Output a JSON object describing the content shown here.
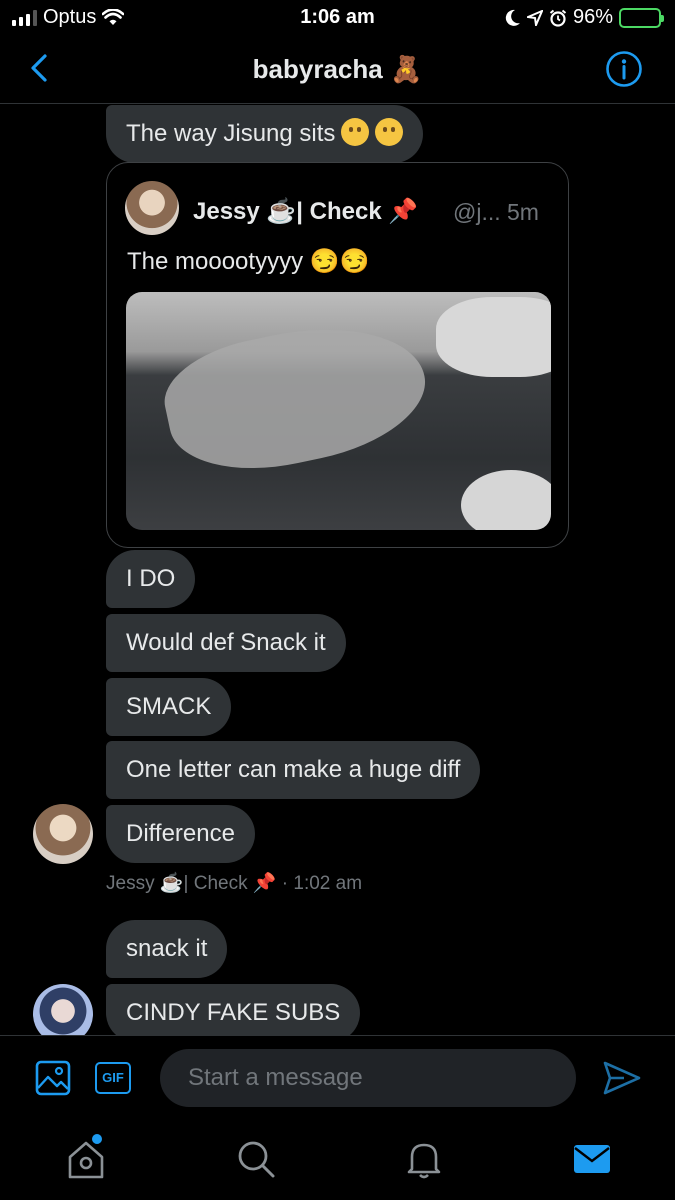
{
  "status_bar": {
    "carrier": "Optus",
    "time": "1:06 am",
    "battery": "96%"
  },
  "header": {
    "title": "babyracha 🧸"
  },
  "messages": [
    {
      "text": "The way Jisung sits",
      "emoji_count": 2
    },
    {
      "text": "I DO"
    },
    {
      "text": "Would def Snack it"
    },
    {
      "text": "SMACK"
    },
    {
      "text": "One letter can make a huge diff"
    },
    {
      "text": "Difference"
    },
    {
      "text": "snack it"
    },
    {
      "text": "CINDY FAKE SUBS"
    }
  ],
  "quoted_tweet": {
    "author": "Jessy ☕️| Check 📌",
    "handle_time": "@j... 5m",
    "text": "The mooootyyyy 😏😏"
  },
  "message_meta": "Jessy ☕️| Check 📌 · 1:02 am",
  "composer": {
    "placeholder": "Start a message",
    "gif_label": "GIF"
  },
  "colors": {
    "accent": "#1d9bf0",
    "bubble": "#2f3336",
    "background": "#000000"
  },
  "icons": {
    "back": "chevron-left-icon",
    "info": "info-icon",
    "media": "image-icon",
    "send": "send-icon",
    "tabs": [
      "home-icon",
      "search-icon",
      "bell-icon",
      "mail-icon"
    ]
  }
}
